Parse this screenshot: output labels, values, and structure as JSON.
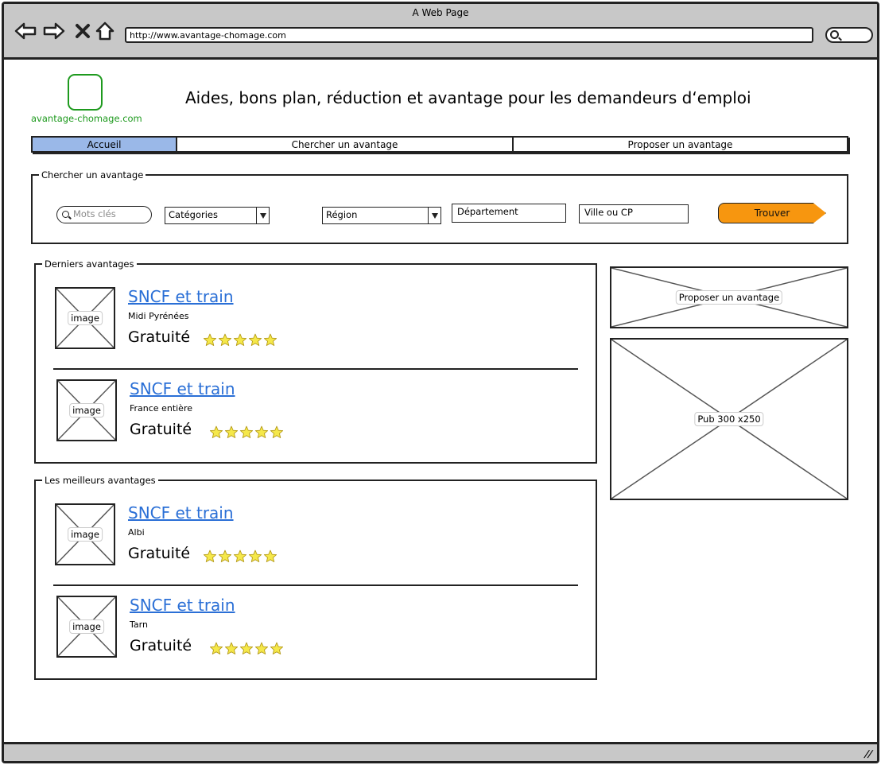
{
  "browser": {
    "title": "A Web Page",
    "url": "http://www.avantage-chomage.com"
  },
  "site": {
    "logo_text": "avantage-chomage.com",
    "headline": "Aides, bons plan, réduction et avantage pour les demandeurs d‘emploi"
  },
  "tabs": [
    {
      "label": "Accueil",
      "active": true
    },
    {
      "label": "Chercher un avantage",
      "active": false
    },
    {
      "label": "Proposer un avantage",
      "active": false
    }
  ],
  "search": {
    "legend": "Chercher un avantage",
    "keywords_placeholder": "Mots clés",
    "category": "Catégories",
    "region": "Région",
    "department": "Département",
    "city": "Ville ou CP",
    "find_button": "Trouver"
  },
  "latest": {
    "legend": "Derniers avantages",
    "items": [
      {
        "image_label": "image",
        "title": "SNCF et train",
        "location": "Midi Pyrénées",
        "price": "Gratuité",
        "rating": 5
      },
      {
        "image_label": "image",
        "title": "SNCF et train",
        "location": "France entière",
        "price": "Gratuité",
        "rating": 5
      }
    ]
  },
  "best": {
    "legend": "Les meilleurs avantages",
    "items": [
      {
        "image_label": "image",
        "title": "SNCF et train",
        "location": "Albi",
        "price": "Gratuité",
        "rating": 5
      },
      {
        "image_label": "image",
        "title": "SNCF et train",
        "location": "Tarn",
        "price": "Gratuité",
        "rating": 5
      }
    ]
  },
  "sidebar": {
    "propose_label": "Proposer un avantage",
    "ad_label": "Pub 300 x250"
  },
  "colors": {
    "active_tab": "#9ab8e8",
    "find_button": "#f7960f",
    "link": "#2a6fd6",
    "logo": "#1e9a1e",
    "star": "#f5e84a"
  }
}
